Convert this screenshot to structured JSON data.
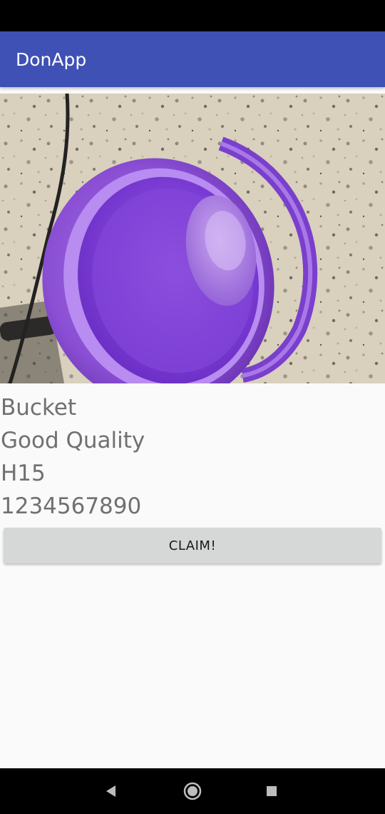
{
  "app_bar": {
    "title": "DonApp",
    "color": "#3f51b5"
  },
  "item": {
    "image_icon": "purple-bucket-photo",
    "name": "Bucket",
    "description": "Good Quality",
    "location": "H15",
    "phone": "1234567890"
  },
  "actions": {
    "claim_label": "CLAIM!"
  },
  "nav": {
    "back_icon": "back-triangle-icon",
    "home_icon": "home-circle-icon",
    "recents_icon": "recents-square-icon"
  }
}
